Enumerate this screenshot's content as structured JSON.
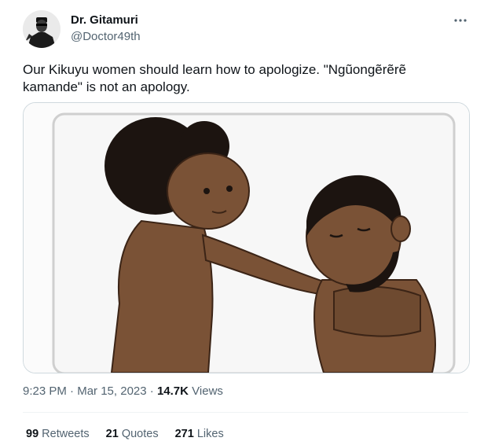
{
  "author": {
    "display_name": "Dr. Gitamuri",
    "handle": "@Doctor49th"
  },
  "more_icon": "more-horizontal-icon",
  "tweet": {
    "text_line1": "Our Kikuyu women should learn how to apologize. \"Ngũongẽrẽrẽ",
    "text_line2": "kamande\" is not an apology."
  },
  "meta": {
    "time": "9:23 PM",
    "separator": "·",
    "date": "Mar 15, 2023",
    "views_count": "14.7K",
    "views_label": "Views"
  },
  "stats": {
    "retweets_count": "99",
    "retweets_label": "Retweets",
    "quotes_count": "21",
    "quotes_label": "Quotes",
    "likes_count": "271",
    "likes_label": "Likes"
  },
  "colors": {
    "text_primary": "#0f1419",
    "text_secondary": "#536471",
    "border": "#cfd9de",
    "skin": "#7a5236",
    "hair": "#1c1410"
  }
}
